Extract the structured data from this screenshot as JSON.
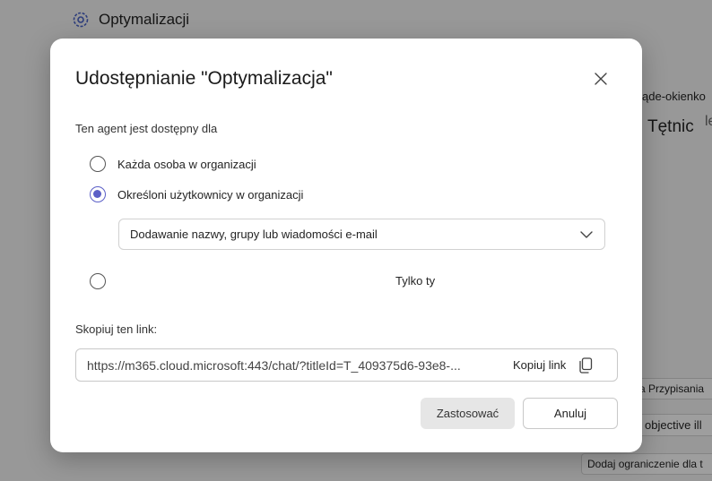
{
  "background": {
    "app_title": "Optymalizacji",
    "app_icon": "gear-icon",
    "fragment_1": "ąde-okienko",
    "fragment_2": "Tętnic",
    "fragment_3": "le",
    "chip_1": "a Przypisania",
    "chip_2": "objective ill",
    "chip_3": "Dodaj ograniczenie dla t"
  },
  "dialog": {
    "title": "Udostępnianie \"Optymalizacja\"",
    "close_icon": "close-icon",
    "availability_label": "Ten agent jest dostępny dla",
    "options": [
      {
        "label": "Każda osoba w organizacji",
        "checked": false
      },
      {
        "label": "Określoni użytkownicy w organizacji",
        "checked": true
      },
      {
        "label": "",
        "checked": false
      }
    ],
    "people_picker": {
      "placeholder": "Dodawanie nazwy, grupy lub wiadomości e-mail",
      "icon": "chevron-down-icon"
    },
    "only_label": "Tylko ty",
    "copy_label": "Skopiuj ten link:",
    "link": "https://m365.cloud.microsoft:443/chat/?titleId=T_409375d6-93e8-...",
    "copy_link_label": "Kopiuj link",
    "copy_icon": "copy-icon",
    "apply_label": "Zastosować",
    "cancel_label": "Anuluj",
    "accent_color": "#5b5fc7"
  }
}
